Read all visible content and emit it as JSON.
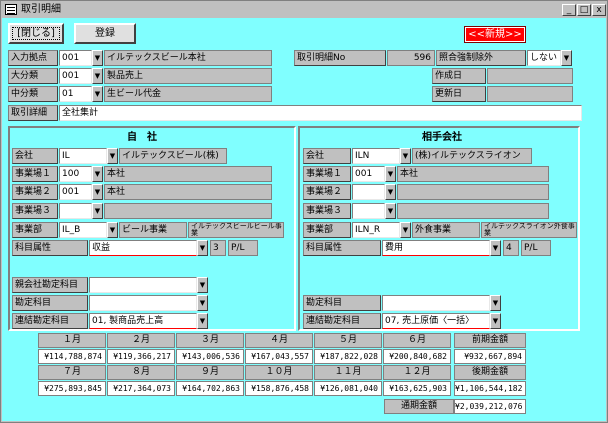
{
  "window": {
    "title": "取引明細",
    "min": "_",
    "max": "□",
    "close": "x"
  },
  "toolbar": {
    "close_label": "[閉じる]",
    "register_label": "登録",
    "new_badge": "<<新規>>"
  },
  "header": {
    "entry_base_label": "入力拠点",
    "entry_base_code": "001",
    "entry_base_name": "イルテックスビール本社",
    "major_label": "大分類",
    "major_code": "001",
    "major_name": "製品売上",
    "minor_label": "中分類",
    "minor_code": "01",
    "minor_name": "生ビール代金",
    "detail_label": "取引詳細",
    "detail_value": "全社集計",
    "tx_no_label": "取引明細No",
    "tx_no_value": "596",
    "exclude_label": "照合強制除外",
    "exclude_value": "しない",
    "created_label": "作成日",
    "created_value": "",
    "updated_label": "更新日",
    "updated_value": ""
  },
  "own": {
    "title": "自　社",
    "company_label": "会社",
    "company_code": "IL",
    "company_name": "イルテックスビール(株)",
    "site1_label": "事業場１",
    "site1_code": "100",
    "site1_name": "本社",
    "site2_label": "事業場２",
    "site2_code": "001",
    "site2_name": "本社",
    "site3_label": "事業場３",
    "site3_code": "",
    "site3_name": "",
    "dept_label": "事業部",
    "dept_code": "IL_B",
    "dept_name": "ビール事業",
    "dept_extra": "イルテックスビールビール事業",
    "acct_attr_label": "科目属性",
    "acct_attr_value": "収益",
    "acct_attr_num": "3",
    "acct_attr_pl": "P/L",
    "parent_acct_label": "親会社勘定科目",
    "parent_acct_value": "",
    "acct_label": "勘定科目",
    "acct_value": "",
    "consol_label": "連結勘定科目",
    "consol_value": "01, 製商品売上高"
  },
  "partner": {
    "title": "相手会社",
    "company_label": "会社",
    "company_code": "ILN",
    "company_name": "(株)イルテックスライオン",
    "site1_label": "事業場１",
    "site1_code": "001",
    "site1_name": "本社",
    "site2_label": "事業場２",
    "site2_code": "",
    "site2_name": "",
    "site3_label": "事業場３",
    "site3_code": "",
    "site3_name": "",
    "dept_label": "事業部",
    "dept_code": "ILN_R",
    "dept_name": "外食事業",
    "dept_extra": "イルテックスライオン外食事業",
    "acct_attr_label": "科目属性",
    "acct_attr_value": "費用",
    "acct_attr_num": "4",
    "acct_attr_pl": "P/L",
    "acct_label": "勘定科目",
    "acct_value": "",
    "consol_label": "連結勘定科目",
    "consol_value": "07, 売上原価〈一括〉"
  },
  "monthly": {
    "row1_headers": [
      "１月",
      "２月",
      "３月",
      "４月",
      "５月",
      "６月"
    ],
    "row1_values": [
      "¥114,788,874",
      "¥119,366,217",
      "¥143,006,536",
      "¥167,043,557",
      "¥187,822,028",
      "¥200,840,682"
    ],
    "row2_headers": [
      "７月",
      "８月",
      "９月",
      "１０月",
      "１１月",
      "１２月"
    ],
    "row2_values": [
      "¥275,893,845",
      "¥217,364,073",
      "¥164,702,863",
      "¥158,876,458",
      "¥126,081,040",
      "¥163,625,903"
    ],
    "first_half_label": "前期金額",
    "first_half_value": "¥932,667,894",
    "second_half_label": "後期金額",
    "second_half_value": "¥1,106,544,182",
    "total_label": "通期金額",
    "total_value": "¥2,039,212,076"
  }
}
